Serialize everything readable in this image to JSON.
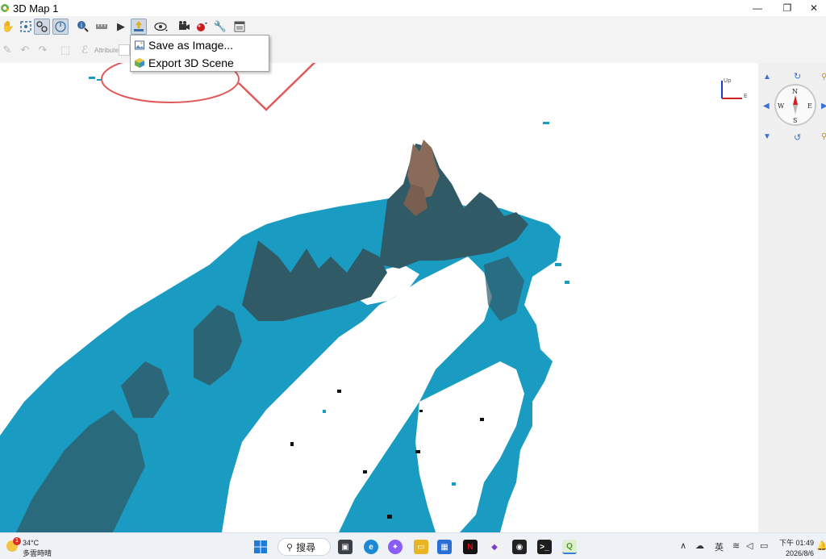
{
  "window": {
    "title": "3D Map 1",
    "controls": {
      "minimize": "—",
      "restore": "❐",
      "close": "✕"
    }
  },
  "toolbar": {
    "attribute_label": "Attribute"
  },
  "export_menu": {
    "items": [
      {
        "label": "Save as Image...",
        "icon": "image-save-icon"
      },
      {
        "label": "Export 3D Scene",
        "icon": "cube-export-icon"
      }
    ]
  },
  "viewport": {
    "axis_labels": {
      "up": "Up",
      "east": "E"
    },
    "colors": {
      "terrain": "#1a9bc2",
      "terrain_dark": "#2f5a66",
      "peak": "#8a6b5a",
      "annotation": "#e05a5a"
    }
  },
  "navigation": {
    "compass": {
      "n": "N",
      "s": "S",
      "e": "E",
      "w": "W"
    }
  },
  "taskbar": {
    "weather": {
      "temperature": "34°C",
      "condition": "多雲時晴",
      "badge": "1"
    },
    "search_label": "搜尋",
    "ime_label": "英",
    "clock": {
      "time": "下午 01:49",
      "date": "2026/8/6"
    }
  }
}
